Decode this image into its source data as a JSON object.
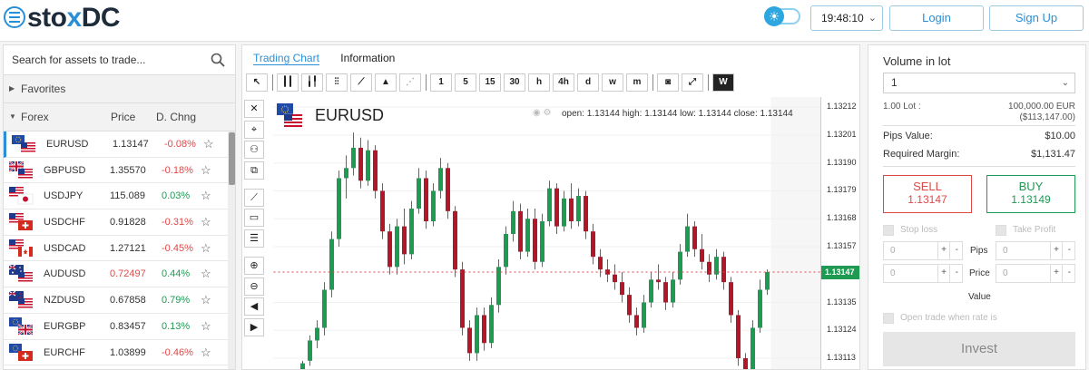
{
  "header": {
    "logo_pre": "sto",
    "logo_x": "x",
    "logo_post": "DC",
    "time": "19:48:10",
    "login_label": "Login",
    "signup_label": "Sign Up"
  },
  "left": {
    "search_placeholder": "Search for assets to trade...",
    "favorites_label": "Favorites",
    "forex_label": "Forex",
    "col_price": "Price",
    "col_change": "D. Chng",
    "assets": [
      {
        "symbol": "EURUSD",
        "price": "1.13147",
        "change": "-0.08%",
        "price_color": "default",
        "flag_top": "eu",
        "flag_bottom": "us"
      },
      {
        "symbol": "GBPUSD",
        "price": "1.35570",
        "change": "-0.18%",
        "price_color": "default",
        "flag_top": "gb",
        "flag_bottom": "us"
      },
      {
        "symbol": "USDJPY",
        "price": "115.089",
        "change": "0.03%",
        "price_color": "default",
        "flag_top": "us",
        "flag_bottom": "jp"
      },
      {
        "symbol": "USDCHF",
        "price": "0.91828",
        "change": "-0.31%",
        "price_color": "default",
        "flag_top": "us",
        "flag_bottom": "ch"
      },
      {
        "symbol": "USDCAD",
        "price": "1.27121",
        "change": "-0.45%",
        "price_color": "default",
        "flag_top": "us",
        "flag_bottom": "ca"
      },
      {
        "symbol": "AUDUSD",
        "price": "0.72497",
        "change": "0.44%",
        "price_color": "red",
        "flag_top": "au",
        "flag_bottom": "us"
      },
      {
        "symbol": "NZDUSD",
        "price": "0.67858",
        "change": "0.79%",
        "price_color": "default",
        "flag_top": "nz",
        "flag_bottom": "us"
      },
      {
        "symbol": "EURGBP",
        "price": "0.83457",
        "change": "0.13%",
        "price_color": "default",
        "flag_top": "eu",
        "flag_bottom": "gb"
      },
      {
        "symbol": "EURCHF",
        "price": "1.03899",
        "change": "-0.46%",
        "price_color": "default",
        "flag_top": "eu",
        "flag_bottom": "ch"
      }
    ]
  },
  "chart": {
    "tabs": [
      "Trading Chart",
      "Information"
    ],
    "active_tab": 0,
    "intervals": [
      "1",
      "5",
      "15",
      "30",
      "h",
      "4h",
      "d",
      "w",
      "m"
    ],
    "symbol": "EURUSD",
    "ohlc": "open: 1.13144 high: 1.13144 low: 1.13144 close: 1.13144",
    "current_price": "1.13147",
    "price_ticks": [
      "1.13212",
      "1.13201",
      "1.13190",
      "1.13179",
      "1.13168",
      "1.13157",
      "1.13135",
      "1.13124",
      "1.13113"
    ],
    "colors": {
      "up": "#1f9a53",
      "down": "#b0182a",
      "accent": "#2a8fd6"
    }
  },
  "chart_data": {
    "type": "candlestick",
    "title": "EURUSD",
    "ylim": [
      1.13108,
      1.13216
    ],
    "series": [
      {
        "name": "EURUSD",
        "candles": [
          {
            "o": 1.13108,
            "h": 1.13112,
            "l": 1.13104,
            "c": 1.13111
          },
          {
            "o": 1.13112,
            "h": 1.13122,
            "l": 1.1311,
            "c": 1.1312
          },
          {
            "o": 1.1312,
            "h": 1.13128,
            "l": 1.13117,
            "c": 1.13125
          },
          {
            "o": 1.13125,
            "h": 1.13143,
            "l": 1.13122,
            "c": 1.1314
          },
          {
            "o": 1.1314,
            "h": 1.13163,
            "l": 1.13137,
            "c": 1.1316
          },
          {
            "o": 1.1316,
            "h": 1.13187,
            "l": 1.13157,
            "c": 1.13184
          },
          {
            "o": 1.13184,
            "h": 1.13193,
            "l": 1.13176,
            "c": 1.13188
          },
          {
            "o": 1.13188,
            "h": 1.13202,
            "l": 1.13185,
            "c": 1.13196
          },
          {
            "o": 1.13196,
            "h": 1.132,
            "l": 1.1318,
            "c": 1.13183
          },
          {
            "o": 1.13183,
            "h": 1.13199,
            "l": 1.13181,
            "c": 1.13195
          },
          {
            "o": 1.13195,
            "h": 1.13197,
            "l": 1.13176,
            "c": 1.13179
          },
          {
            "o": 1.13179,
            "h": 1.13182,
            "l": 1.1316,
            "c": 1.13163
          },
          {
            "o": 1.13163,
            "h": 1.13166,
            "l": 1.13146,
            "c": 1.13149
          },
          {
            "o": 1.13149,
            "h": 1.13168,
            "l": 1.13146,
            "c": 1.13165
          },
          {
            "o": 1.13165,
            "h": 1.13172,
            "l": 1.1315,
            "c": 1.13154
          },
          {
            "o": 1.13154,
            "h": 1.13175,
            "l": 1.13152,
            "c": 1.13172
          },
          {
            "o": 1.13172,
            "h": 1.13188,
            "l": 1.1317,
            "c": 1.13184
          },
          {
            "o": 1.13184,
            "h": 1.13187,
            "l": 1.13164,
            "c": 1.13167
          },
          {
            "o": 1.13167,
            "h": 1.13182,
            "l": 1.13165,
            "c": 1.13179
          },
          {
            "o": 1.13179,
            "h": 1.13192,
            "l": 1.13176,
            "c": 1.13188
          },
          {
            "o": 1.13188,
            "h": 1.1319,
            "l": 1.13168,
            "c": 1.13171
          },
          {
            "o": 1.13171,
            "h": 1.13173,
            "l": 1.13145,
            "c": 1.13148
          },
          {
            "o": 1.13148,
            "h": 1.13151,
            "l": 1.13122,
            "c": 1.13125
          },
          {
            "o": 1.13125,
            "h": 1.13128,
            "l": 1.13112,
            "c": 1.13115
          },
          {
            "o": 1.13115,
            "h": 1.13133,
            "l": 1.13112,
            "c": 1.1313
          },
          {
            "o": 1.1313,
            "h": 1.13133,
            "l": 1.13116,
            "c": 1.13119
          },
          {
            "o": 1.13119,
            "h": 1.13137,
            "l": 1.13117,
            "c": 1.13134
          },
          {
            "o": 1.13134,
            "h": 1.13152,
            "l": 1.13131,
            "c": 1.13149
          },
          {
            "o": 1.13149,
            "h": 1.13165,
            "l": 1.13146,
            "c": 1.13162
          },
          {
            "o": 1.13162,
            "h": 1.13175,
            "l": 1.13159,
            "c": 1.13171
          },
          {
            "o": 1.13171,
            "h": 1.13174,
            "l": 1.13152,
            "c": 1.13155
          },
          {
            "o": 1.13155,
            "h": 1.13172,
            "l": 1.13153,
            "c": 1.13168
          },
          {
            "o": 1.13168,
            "h": 1.13172,
            "l": 1.13148,
            "c": 1.13151
          },
          {
            "o": 1.13151,
            "h": 1.1317,
            "l": 1.13149,
            "c": 1.13167
          },
          {
            "o": 1.13167,
            "h": 1.13183,
            "l": 1.13165,
            "c": 1.1318
          },
          {
            "o": 1.1318,
            "h": 1.13182,
            "l": 1.13162,
            "c": 1.13165
          },
          {
            "o": 1.13165,
            "h": 1.13179,
            "l": 1.13163,
            "c": 1.13176
          },
          {
            "o": 1.13176,
            "h": 1.13182,
            "l": 1.13164,
            "c": 1.13167
          },
          {
            "o": 1.13167,
            "h": 1.1318,
            "l": 1.13165,
            "c": 1.13177
          },
          {
            "o": 1.13177,
            "h": 1.13179,
            "l": 1.1316,
            "c": 1.13163
          },
          {
            "o": 1.13163,
            "h": 1.13166,
            "l": 1.1315,
            "c": 1.13153
          },
          {
            "o": 1.13153,
            "h": 1.13156,
            "l": 1.13145,
            "c": 1.13148
          },
          {
            "o": 1.13148,
            "h": 1.13152,
            "l": 1.13143,
            "c": 1.13146
          },
          {
            "o": 1.13146,
            "h": 1.1315,
            "l": 1.1314,
            "c": 1.13143
          },
          {
            "o": 1.13143,
            "h": 1.13147,
            "l": 1.13135,
            "c": 1.13138
          },
          {
            "o": 1.13138,
            "h": 1.13141,
            "l": 1.13127,
            "c": 1.1313
          },
          {
            "o": 1.1313,
            "h": 1.13133,
            "l": 1.13122,
            "c": 1.13125
          },
          {
            "o": 1.13125,
            "h": 1.13138,
            "l": 1.13123,
            "c": 1.13135
          },
          {
            "o": 1.13135,
            "h": 1.13147,
            "l": 1.13133,
            "c": 1.13144
          },
          {
            "o": 1.13144,
            "h": 1.1315,
            "l": 1.1314,
            "c": 1.13143
          },
          {
            "o": 1.13143,
            "h": 1.13145,
            "l": 1.13132,
            "c": 1.13135
          },
          {
            "o": 1.13135,
            "h": 1.13147,
            "l": 1.13133,
            "c": 1.13144
          },
          {
            "o": 1.13144,
            "h": 1.13158,
            "l": 1.13142,
            "c": 1.13155
          },
          {
            "o": 1.13155,
            "h": 1.1317,
            "l": 1.13153,
            "c": 1.13165
          },
          {
            "o": 1.13165,
            "h": 1.13167,
            "l": 1.13153,
            "c": 1.13156
          },
          {
            "o": 1.13156,
            "h": 1.13162,
            "l": 1.13148,
            "c": 1.13151
          },
          {
            "o": 1.13151,
            "h": 1.13154,
            "l": 1.13143,
            "c": 1.13146
          },
          {
            "o": 1.13146,
            "h": 1.13156,
            "l": 1.13144,
            "c": 1.13153
          },
          {
            "o": 1.13153,
            "h": 1.13155,
            "l": 1.1314,
            "c": 1.13143
          },
          {
            "o": 1.13143,
            "h": 1.13145,
            "l": 1.13127,
            "c": 1.1313
          },
          {
            "o": 1.1313,
            "h": 1.13132,
            "l": 1.1311,
            "c": 1.13113
          },
          {
            "o": 1.13113,
            "h": 1.13115,
            "l": 1.13106,
            "c": 1.13108
          },
          {
            "o": 1.13108,
            "h": 1.13128,
            "l": 1.13106,
            "c": 1.13125
          },
          {
            "o": 1.13125,
            "h": 1.13144,
            "l": 1.13123,
            "c": 1.1314
          },
          {
            "o": 1.1314,
            "h": 1.13148,
            "l": 1.13138,
            "c": 1.13147
          }
        ]
      }
    ]
  },
  "right": {
    "volume_label": "Volume in lot",
    "lot_value": "1",
    "lot_info_label": "1.00 Lot :",
    "lot_info_value": "100,000.00 EUR",
    "lot_info_value2": "($113,147.00)",
    "pips_label": "Pips Value:",
    "pips_value": "$10.00",
    "margin_label": "Required Margin:",
    "margin_value": "$1,131.47",
    "sell_label": "SELL",
    "sell_price": "1.13147",
    "buy_label": "BUY",
    "buy_price": "1.13149",
    "stop_loss_label": "Stop loss",
    "take_profit_label": "Take Profit",
    "input_zero": "0",
    "pips_mid": "Pips",
    "price_mid": "Price",
    "value_mid": "Value",
    "open_trade_label": "Open trade when rate is",
    "invest_label": "Invest"
  }
}
